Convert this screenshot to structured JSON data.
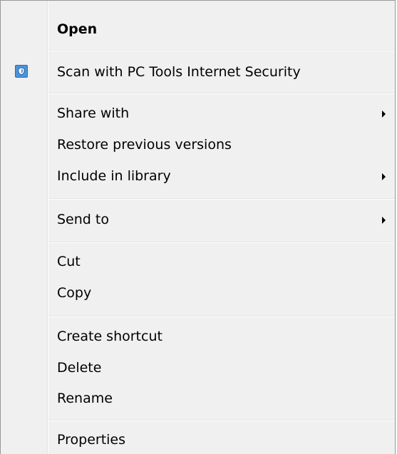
{
  "context_menu": {
    "items": {
      "open": "Open",
      "scan": "Scan with PC Tools Internet Security",
      "share_with": "Share with",
      "restore_previous_versions": "Restore previous versions",
      "include_in_library": "Include in library",
      "send_to": "Send to",
      "cut": "Cut",
      "copy": "Copy",
      "create_shortcut": "Create shortcut",
      "delete": "Delete",
      "rename": "Rename",
      "properties": "Properties"
    },
    "icons": {
      "scan": "shield-icon",
      "submenu": "chevron-right-icon"
    },
    "colors": {
      "background": "#f0f0f0",
      "border": "#979797",
      "separator": "#e2e3e3",
      "scan_icon": "#4c93d9"
    }
  }
}
